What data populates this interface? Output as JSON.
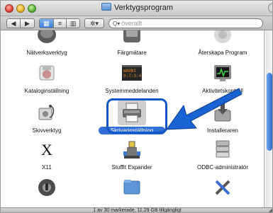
{
  "window": {
    "title": "Verktygsprogram"
  },
  "toolbar": {
    "back_glyph": "◀",
    "forward_glyph": "▶",
    "view_icons_glyph": "▦",
    "view_list_glyph": "≡",
    "view_columns_glyph": "▥",
    "action_glyph": "✲▾",
    "search_glass": "Q▾",
    "search_placeholder": "överallt"
  },
  "items": [
    {
      "label": "Nätverksverktyg",
      "icon": "network-utility-icon"
    },
    {
      "label": "Färgmätare",
      "icon": "color-meter-icon"
    },
    {
      "label": "Återskapa Program",
      "icon": "recover-app-icon"
    },
    {
      "label": "Kataloginställning",
      "icon": "directory-setup-icon"
    },
    {
      "label": "Systemmeddelanden",
      "icon": "console-icon"
    },
    {
      "label": "Aktivitetskontroll",
      "icon": "activity-monitor-icon"
    },
    {
      "label": "Skivverktyg",
      "icon": "disk-utility-icon"
    },
    {
      "label": "Skrivarinställning",
      "icon": "printer-setup-icon",
      "selected": true
    },
    {
      "label": "Installeraren",
      "icon": "installer-icon"
    },
    {
      "label": "X11",
      "icon": "x11-icon"
    },
    {
      "label": "StuffIt Expander",
      "icon": "stuffit-icon"
    },
    {
      "label": "ODBC-administratör",
      "icon": "odbc-icon"
    },
    {
      "label": "",
      "icon": "help-utility-icon"
    },
    {
      "label": "",
      "icon": "folder-icon"
    },
    {
      "label": "",
      "icon": "tools-icon"
    }
  ],
  "status": {
    "text": "1 av 30 markerade, 11.29 GB tillgängligt"
  },
  "colors": {
    "selection": "#2f6fd6",
    "highlight_border": "#1157c8",
    "arrow": "#1a63d3"
  },
  "icon_text": {
    "x11": "X",
    "console": "WARNI\n9:7:3:4"
  }
}
